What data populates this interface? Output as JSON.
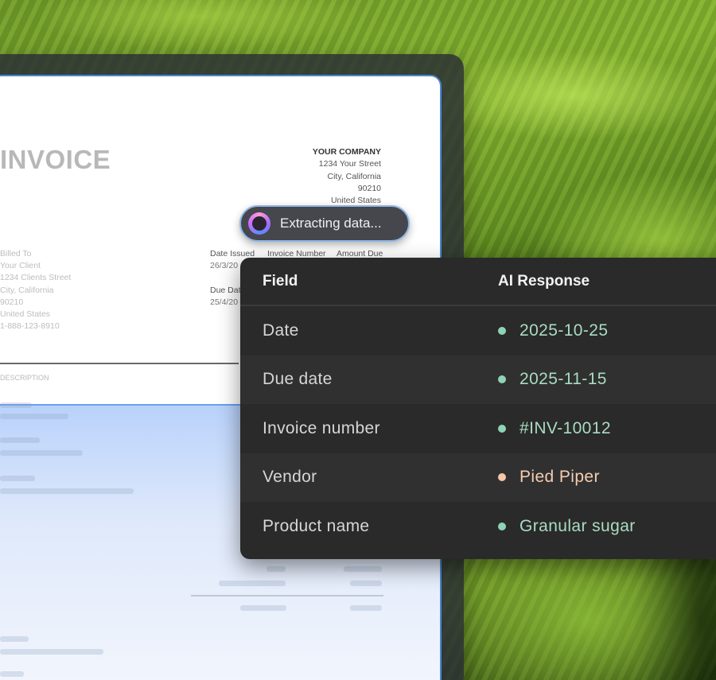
{
  "invoice": {
    "title": "INVOICE",
    "company": {
      "name": "YOUR COMPANY",
      "street": "1234 Your Street",
      "city": "City, California",
      "zip": "90210",
      "country": "United States"
    },
    "billed_to": {
      "label": "Billed To",
      "client": "Your Client",
      "street": "1234 Clients Street",
      "city": "City, California",
      "zip": "90210",
      "country": "United States",
      "phone": "1-888-123-8910"
    },
    "date_issued_label": "Date Issued",
    "date_issued": "26/3/20",
    "due_date_label": "Due Date",
    "due_date": "25/4/20",
    "invoice_number_label": "Invoice Number",
    "amount_due_label": "Amount Due",
    "description_label": "DESCRIPTION"
  },
  "status_pill": {
    "label": "Extracting data..."
  },
  "extraction_table": {
    "headers": {
      "field": "Field",
      "response": "AI Response"
    },
    "rows": [
      {
        "field": "Date",
        "value": "2025-10-25",
        "status_color": "#8fd3b6",
        "text_color": "#a9dcc3"
      },
      {
        "field": "Due date",
        "value": "2025-11-15",
        "status_color": "#8fd3b6",
        "text_color": "#a9dcc3"
      },
      {
        "field": "Invoice number",
        "value": "#INV-10012",
        "status_color": "#8fd3b6",
        "text_color": "#a9dcc3"
      },
      {
        "field": "Vendor",
        "value": "Pied Piper",
        "status_color": "#f5c6a8",
        "text_color": "#f4cdb2"
      },
      {
        "field": "Product name",
        "value": "Granular sugar",
        "status_color": "#8fd3b6",
        "text_color": "#a9dcc3"
      }
    ]
  }
}
